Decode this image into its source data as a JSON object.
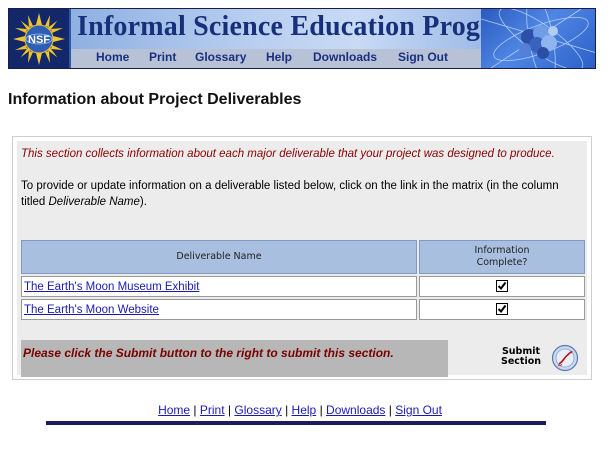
{
  "banner": {
    "logo_text": "NSF",
    "title": "Informal Science Education Program",
    "nav": [
      "Home",
      "Print",
      "Glossary",
      "Help",
      "Downloads",
      "Sign Out"
    ]
  },
  "page": {
    "title": "Information about Project Deliverables"
  },
  "intro": {
    "note": "This section collects information about each major deliverable that your project was designed to produce.",
    "instruction_prefix": "To provide or update information on a deliverable listed below, click on the link in the matrix (in the column titled ",
    "instruction_em": "Deliverable Name",
    "instruction_suffix": ")."
  },
  "table": {
    "headers": [
      "Deliverable Name",
      "Information Complete?"
    ],
    "rows": [
      {
        "name": "The Earth's Moon Museum Exhibit",
        "complete": true
      },
      {
        "name": "The Earth's Moon Website",
        "complete": true
      }
    ]
  },
  "submit": {
    "message": "Please click the Submit button to the right to submit this section.",
    "label_line1": "Submit",
    "label_line2": "Section"
  },
  "footer": {
    "links": [
      "Home",
      "Print",
      "Glossary",
      "Help",
      "Downloads",
      "Sign Out"
    ],
    "separator": "|"
  },
  "colors": {
    "banner_navy": "#12286a",
    "nav_text": "#1a2f82",
    "header_blue": "#a8bfe0",
    "note_red": "#8a0000",
    "link_blue": "#1a1ab3"
  }
}
